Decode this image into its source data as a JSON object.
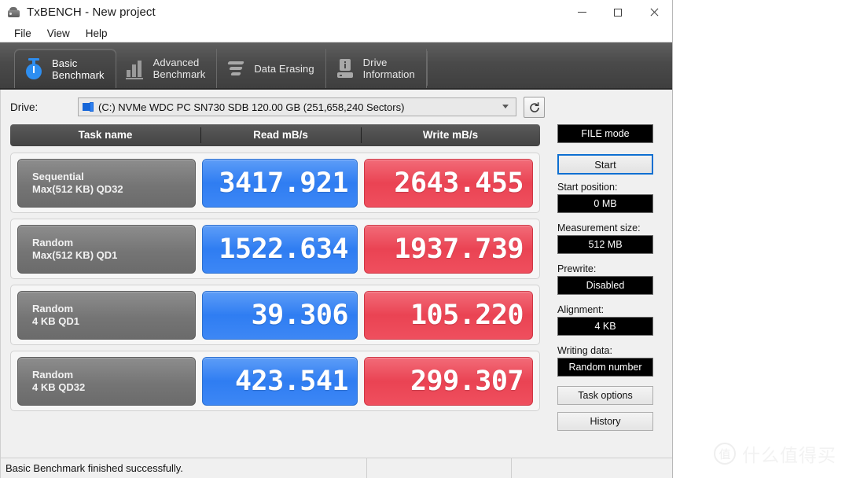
{
  "window": {
    "title": "TxBENCH - New project",
    "icon": "txbench-app-icon",
    "controls": {
      "minimize": "minimize-icon",
      "maximize": "maximize-icon",
      "close": "close-icon"
    }
  },
  "menu": {
    "items": [
      "File",
      "View",
      "Help"
    ]
  },
  "tabs": [
    {
      "label": "Basic\nBenchmark",
      "icon": "stopwatch-icon",
      "active": true
    },
    {
      "label": "Advanced\nBenchmark",
      "icon": "bar-chart-icon",
      "active": false
    },
    {
      "label": "Data Erasing",
      "icon": "erase-icon",
      "active": false
    },
    {
      "label": "Drive\nInformation",
      "icon": "drive-info-icon",
      "active": false
    }
  ],
  "drive": {
    "label": "Drive:",
    "selected": "(C:) NVMe WDC PC SN730 SDB  120.00 GB (251,658,240 Sectors)",
    "icon": "drive-icon",
    "refresh_icon": "refresh-icon"
  },
  "results": {
    "columns": [
      "Task name",
      "Read mB/s",
      "Write mB/s"
    ],
    "rows": [
      {
        "task_line1": "Sequential",
        "task_line2": "Max(512 KB) QD32",
        "read": "3417.921",
        "write": "2643.455"
      },
      {
        "task_line1": "Random",
        "task_line2": "Max(512 KB) QD1",
        "read": "1522.634",
        "write": "1937.739"
      },
      {
        "task_line1": "Random",
        "task_line2": "4 KB QD1",
        "read": "39.306",
        "write": "105.220"
      },
      {
        "task_line1": "Random",
        "task_line2": "4 KB QD32",
        "read": "423.541",
        "write": "299.307"
      }
    ]
  },
  "panel": {
    "mode_button": "FILE mode",
    "start_button": "Start",
    "fields": [
      {
        "label": "Start position:",
        "value": "0 MB"
      },
      {
        "label": "Measurement size:",
        "value": "512 MB"
      },
      {
        "label": "Prewrite:",
        "value": "Disabled"
      },
      {
        "label": "Alignment:",
        "value": "4 KB"
      },
      {
        "label": "Writing data:",
        "value": "Random number"
      }
    ],
    "task_options_button": "Task options",
    "history_button": "History"
  },
  "statusbar": {
    "message": "Basic Benchmark finished successfully.",
    "segment2": "",
    "segment3": ""
  },
  "watermark": {
    "badge": "值",
    "text": "什么值得买"
  },
  "colors": {
    "read_accent": "#3d87f5",
    "write_accent": "#ef4f5e",
    "tab_active_icon": "#2e8ef0",
    "start_border": "#0d6fd1",
    "field_bg": "#000000"
  }
}
